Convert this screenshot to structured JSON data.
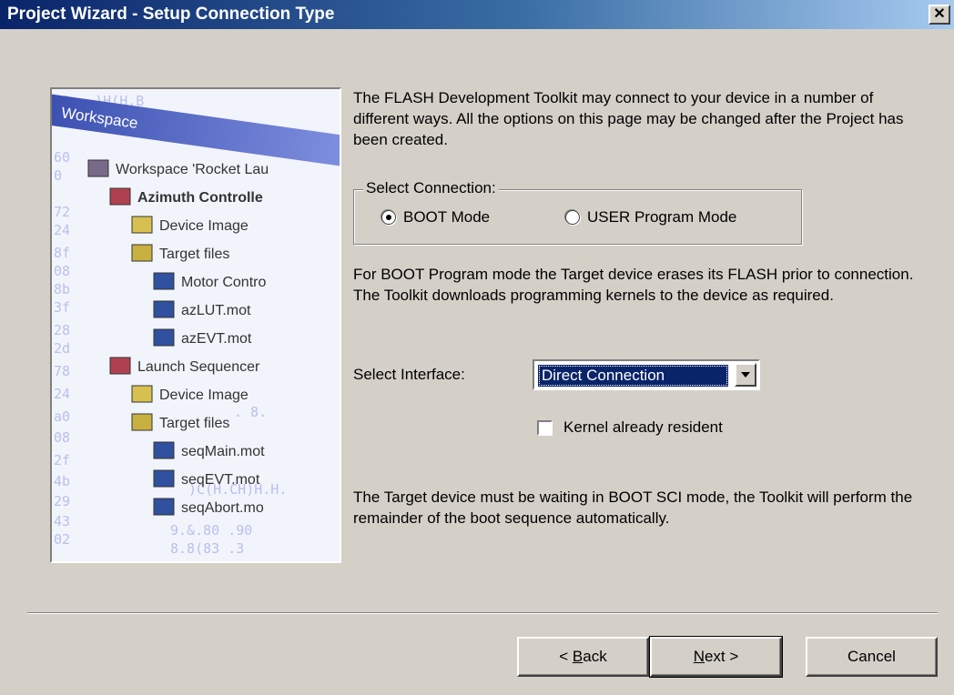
{
  "window": {
    "title": "Project Wizard - Setup Connection Type",
    "close_label": "✕"
  },
  "sidebar_image": {
    "header": "Workspace",
    "tree": [
      {
        "label": "Workspace 'Rocket Lau",
        "indent": 0,
        "icon": "workspace-icon"
      },
      {
        "label": "Azimuth Controlle",
        "indent": 1,
        "icon": "project-icon",
        "bold": true
      },
      {
        "label": "Device Image",
        "indent": 2,
        "icon": "folder-icon"
      },
      {
        "label": "Target files",
        "indent": 2,
        "icon": "folder-open-icon"
      },
      {
        "label": "Motor Contro",
        "indent": 3,
        "icon": "s-file-icon"
      },
      {
        "label": "azLUT.mot",
        "indent": 3,
        "icon": "s-file-icon"
      },
      {
        "label": "azEVT.mot",
        "indent": 3,
        "icon": "s-file-icon"
      },
      {
        "label": "Launch Sequencer",
        "indent": 1,
        "icon": "project-icon"
      },
      {
        "label": "Device Image",
        "indent": 2,
        "icon": "folder-icon"
      },
      {
        "label": "Target files",
        "indent": 2,
        "icon": "folder-open-icon"
      },
      {
        "label": "seqMain.mot",
        "indent": 3,
        "icon": "s-file-icon"
      },
      {
        "label": "seqEVT.mot",
        "indent": 3,
        "icon": "s-file-icon"
      },
      {
        "label": "seqAbort.mo",
        "indent": 3,
        "icon": "s-file-icon"
      }
    ]
  },
  "intro_text": "The FLASH Development Toolkit may connect to your device in a number of different ways. All the options on this page may be changed after the Project has been created.",
  "connection": {
    "legend": "Select Connection:",
    "options": [
      {
        "label": "BOOT Mode",
        "checked": true
      },
      {
        "label": "USER Program Mode",
        "checked": false
      }
    ]
  },
  "boot_description": "For BOOT Program mode the Target device erases its FLASH prior to connection. The Toolkit downloads programming kernels to the device as required.",
  "interface": {
    "label": "Select Interface:",
    "value": "Direct Connection"
  },
  "kernel_checkbox": {
    "label": "Kernel already resident",
    "checked": false
  },
  "boot_note": "The Target device must be waiting in BOOT SCI mode, the Toolkit will perform the remainder of the boot sequence automatically.",
  "buttons": {
    "back": {
      "prefix": "< ",
      "mnemonic": "B",
      "rest": "ack"
    },
    "next": {
      "mnemonic": "N",
      "rest": "ext >"
    },
    "cancel": "Cancel"
  }
}
